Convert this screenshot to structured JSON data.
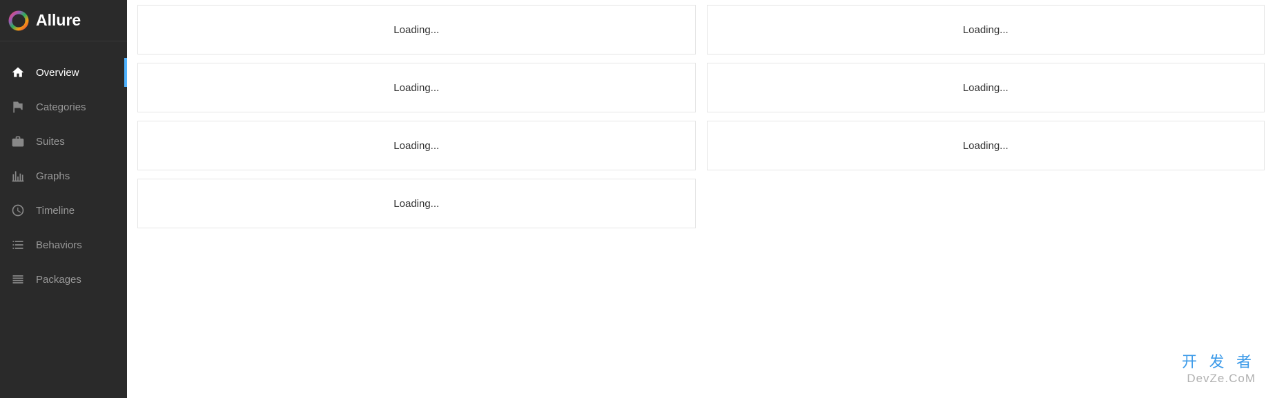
{
  "app": {
    "title": "Allure"
  },
  "sidebar": {
    "items": [
      {
        "label": "Overview",
        "active": true
      },
      {
        "label": "Categories",
        "active": false
      },
      {
        "label": "Suites",
        "active": false
      },
      {
        "label": "Graphs",
        "active": false
      },
      {
        "label": "Timeline",
        "active": false
      },
      {
        "label": "Behaviors",
        "active": false
      },
      {
        "label": "Packages",
        "active": false
      }
    ]
  },
  "main": {
    "left_widgets": [
      {
        "text": "Loading..."
      },
      {
        "text": "Loading..."
      },
      {
        "text": "Loading..."
      },
      {
        "text": "Loading..."
      }
    ],
    "right_widgets": [
      {
        "text": "Loading..."
      },
      {
        "text": "Loading..."
      },
      {
        "text": "Loading..."
      }
    ]
  },
  "watermark": {
    "line1": "开 发 者",
    "line2": "DevZe.CoM"
  }
}
